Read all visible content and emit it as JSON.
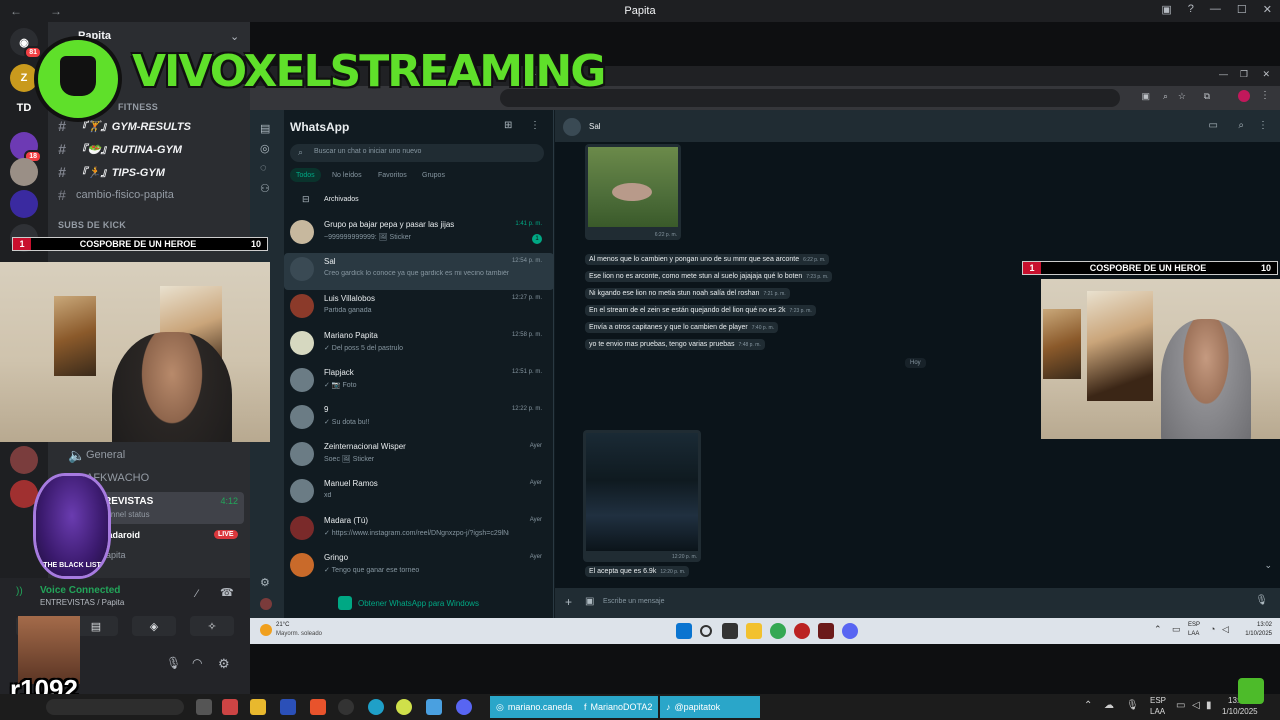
{
  "window": {
    "title": "Papita",
    "nav_back": "←",
    "nav_forward": "→"
  },
  "rail": {
    "servers": [
      {
        "label": "",
        "badge": "81"
      },
      {
        "label": "Z",
        "badge": ""
      },
      {
        "label": "TD",
        "badge": ""
      },
      {
        "label": "",
        "badge": "18"
      },
      {
        "label": "",
        "badge": ""
      },
      {
        "label": "",
        "badge": ""
      },
      {
        "label": "",
        "badge": ""
      }
    ]
  },
  "server": {
    "name": "Papita",
    "chevron": "⌄"
  },
  "channels": {
    "cat_fitness": "FITNESS",
    "items": [
      {
        "name": "『🏋』GYM-RESULTS"
      },
      {
        "name": "『🥗』RUTINA-GYM"
      },
      {
        "name": "『🏃』TIPS-GYM"
      },
      {
        "name": "cambio-fisico-papita"
      }
    ],
    "cat_subs": "SUBS DE KICK",
    "voice": [
      {
        "name": "General"
      },
      {
        "name": "AFKWACHO"
      },
      {
        "name": "ENTREVISTAS",
        "timer": "4:12",
        "sub": "channel status"
      }
    ],
    "live_user": "Madaroid",
    "live_badge": "LIVE",
    "papita_user": "Papita"
  },
  "overlay": {
    "streamer_name": "VIVOXELSTREAMING",
    "watermark": "r1092",
    "bar_left": {
      "num": "1",
      "text": "COSPOBRE DE UN HEROE",
      "right": "10"
    },
    "bar_right": {
      "num": "1",
      "text": "COSPOBRE DE UN HEROE",
      "right": "10"
    },
    "logo_text": "THE BLACK LIST"
  },
  "voice_panel": {
    "status": "Voice Connected",
    "location": "ENTREVISTAS / Papita"
  },
  "whatsapp": {
    "title": "WhatsApp",
    "search_placeholder": "Buscar un chat o iniciar uno nuevo",
    "filters": [
      "Todos",
      "No leídos",
      "Favoritos",
      "Grupos"
    ],
    "archived": "Archivados",
    "chats": [
      {
        "name": "Grupo pa bajar pepa y pasar las jijas",
        "msg": "~999999999999: 🖼 Sticker",
        "time": "1:41 p. m.",
        "unread": "1"
      },
      {
        "name": "Sal",
        "msg": "Creo gardick lo conoce ya que gardick es mi vecino también",
        "time": "12:54 p. m.",
        "unread": ""
      },
      {
        "name": "Luis Villalobos",
        "msg": "Partida ganada",
        "time": "12:27 p. m.",
        "unread": ""
      },
      {
        "name": "Mariano Papita",
        "msg": "✓ Del poss 5 del pastrulo",
        "time": "12:58 p. m.",
        "unread": ""
      },
      {
        "name": "Flapjack",
        "msg": "✓ 📷 Foto",
        "time": "12:51 p. m.",
        "unread": ""
      },
      {
        "name": "9",
        "msg": "✓ Su dota bu!!",
        "time": "12:22 p. m.",
        "unread": ""
      },
      {
        "name": "Zeinternacional Wisper",
        "msg": "Soec 🖼 Sticker",
        "time": "Ayer",
        "unread": ""
      },
      {
        "name": "Manuel Ramos",
        "msg": "xd",
        "time": "Ayer",
        "unread": ""
      },
      {
        "name": "Madara (Tú)",
        "msg": "✓ https://www.instagram.com/reel/DNgnxzpo-j/?igsh=c29lNnlnd2...",
        "time": "Ayer",
        "unread": ""
      },
      {
        "name": "Gringo",
        "msg": "✓ Tengo que ganar ese torneo",
        "time": "Ayer",
        "unread": ""
      }
    ],
    "get_windows": "Obtener WhatsApp para Windows",
    "chat_header": "Sal",
    "image_time": "6:22 p. m.",
    "messages": [
      {
        "text": "Al menos que lo cambien y pongan uno de su mmr que sea arconte",
        "time": "6:22 p. m."
      },
      {
        "text": "Ese lion no es arconte, como mete stun al suelo jajajaja qué lo boten",
        "time": "7:23 p. m."
      },
      {
        "text": "Ni kgando ese lion no metia stun noah salía del roshan",
        "time": "7:21 p. m."
      },
      {
        "text": "En el stream de el zein se están quejando del lion qué no es 2k",
        "time": "7:23 p. m."
      },
      {
        "text": "Envía a otros capitanes y que lo cambien de player",
        "time": "7:40 p. m."
      },
      {
        "text": "yo te envio mas pruebas, tengo varias pruebas",
        "time": "7:48 p. m."
      }
    ],
    "day_label": "Hoy",
    "shot_time": "12:20 p. m.",
    "last_msg": {
      "text": "El acepta que es 6.9k",
      "time": "12:20 p. m."
    },
    "compose_placeholder": "Escribe un mensaje"
  },
  "inner_taskbar": {
    "weather_temp": "21°C",
    "weather_desc": "Mayorm. soleado",
    "lang": "ESP",
    "lang2": "LAA",
    "time": "13:02",
    "date": "1/10/2025"
  },
  "outer_taskbar": {
    "social": [
      {
        "label": "mariano.caneda"
      },
      {
        "label": "MarianoDOTA2"
      },
      {
        "label": "@papitatok"
      }
    ],
    "lang": "ESP",
    "lang2": "LAA",
    "time": "13:02",
    "date": "1/10/2025"
  }
}
